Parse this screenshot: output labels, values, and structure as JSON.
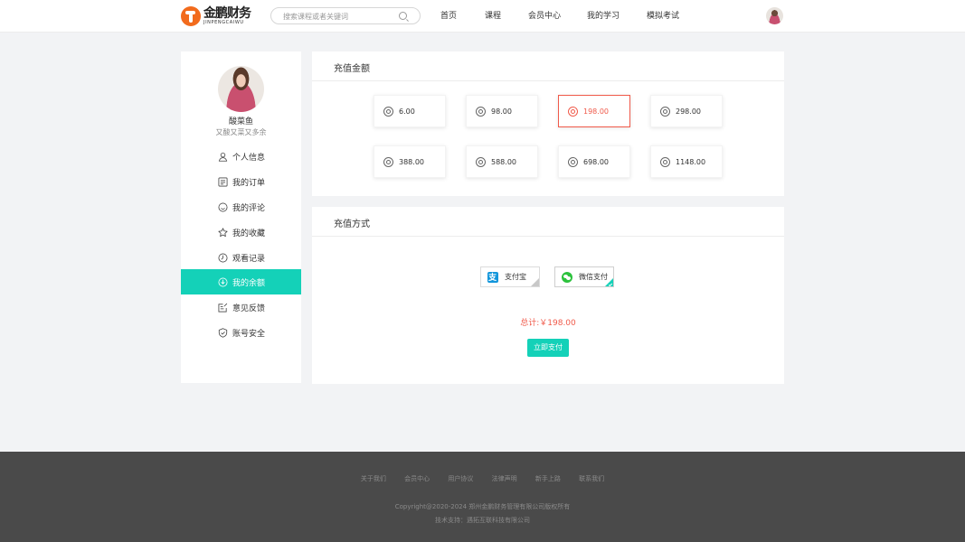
{
  "header": {
    "logo_cn": "金鹏财务",
    "logo_en": "JINPENGCAIWU",
    "search_placeholder": "搜索课程或者关键词",
    "nav": [
      "首页",
      "课程",
      "会员中心",
      "我的学习",
      "模拟考试"
    ]
  },
  "sidebar": {
    "user_name": "酸菜鱼",
    "user_bio": "又酸又菜又多余",
    "items": [
      {
        "label": "个人信息",
        "icon": "user-icon"
      },
      {
        "label": "我的订单",
        "icon": "order-icon"
      },
      {
        "label": "我的评论",
        "icon": "comment-icon"
      },
      {
        "label": "我的收藏",
        "icon": "star-icon"
      },
      {
        "label": "观看记录",
        "icon": "clock-icon"
      },
      {
        "label": "我的余额",
        "icon": "wallet-icon",
        "active": true
      },
      {
        "label": "意见反馈",
        "icon": "feedback-icon"
      },
      {
        "label": "账号安全",
        "icon": "shield-icon"
      }
    ]
  },
  "recharge": {
    "title": "充值金额",
    "amounts": [
      "6.00",
      "98.00",
      "198.00",
      "298.00",
      "388.00",
      "588.00",
      "698.00",
      "1148.00"
    ],
    "selected": "198.00"
  },
  "payment": {
    "title": "充值方式",
    "methods": [
      {
        "label": "支付宝",
        "icon": "alipay-icon",
        "selected": false
      },
      {
        "label": "微信支付",
        "icon": "wechat-icon",
        "selected": true
      }
    ],
    "total": "总计:￥198.00",
    "pay_button": "立即支付"
  },
  "footer": {
    "links": [
      "关于我们",
      "会员中心",
      "用户协议",
      "法律声明",
      "新手上路",
      "联系我们"
    ],
    "copyright": "Copyright@2020-2024 郑州金鹏财务管理有限公司版权所有",
    "support": "技术支持：遇拓互联科技有限公司"
  },
  "colors": {
    "accent": "#14d1b8",
    "price_red": "#f05a4a",
    "logo_orange": "#f26b1d",
    "footer_bg": "#4a4a4a"
  }
}
